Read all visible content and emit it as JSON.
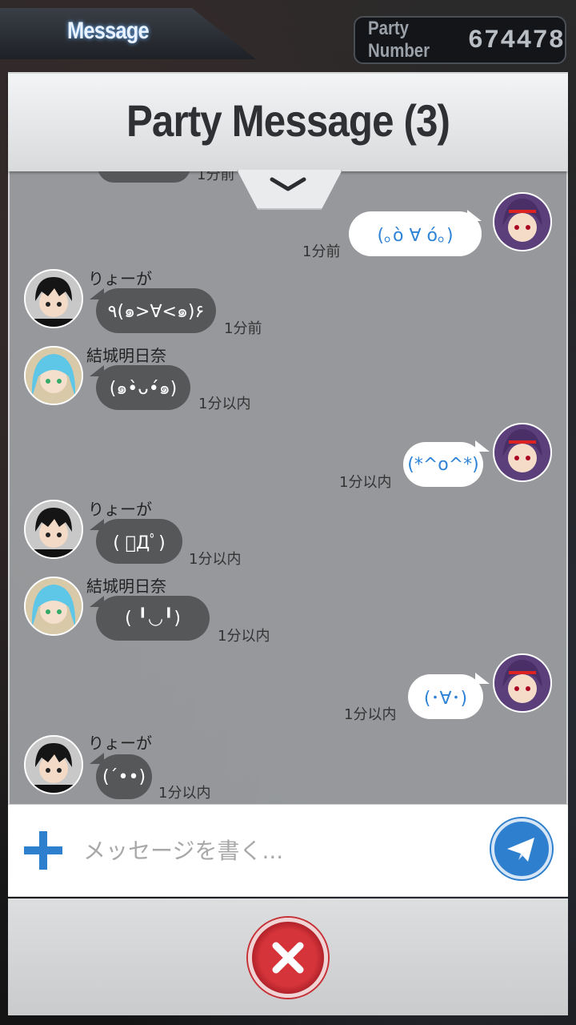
{
  "header": {
    "tab_label": "Message",
    "party_number_label": "Party Number",
    "party_number_value": "674478"
  },
  "dialog": {
    "title": "Party Message (3)"
  },
  "messages": [
    {
      "side": "right",
      "text": "(｡ò ∀ ó｡)",
      "time": "1分前"
    },
    {
      "side": "left",
      "name": "りょーが",
      "text": "٩(๑>∀<๑)۶",
      "time": "1分前",
      "avatar": "black-hair-avatar"
    },
    {
      "side": "left",
      "name": "結城明日奈",
      "text": "(๑•̀ᴗ•́๑)",
      "time": "1分以内",
      "avatar": "blue-hair-avatar"
    },
    {
      "side": "right",
      "text": "(*^o^*)",
      "time": "1分以内"
    },
    {
      "side": "left",
      "name": "りょーが",
      "text": "( ﾟДﾟ)",
      "time": "1分以内",
      "avatar": "black-hair-avatar"
    },
    {
      "side": "left",
      "name": "結城明日奈",
      "text": "( ╹◡╹)",
      "time": "1分以内",
      "avatar": "blue-hair-avatar"
    },
    {
      "side": "right",
      "text": "(･∀･)",
      "time": "1分以内"
    },
    {
      "side": "left",
      "name": "りょーが",
      "text": "(´••)",
      "time": "1分以内",
      "avatar": "black-hair-avatar"
    }
  ],
  "partial_top_time": "1分前",
  "input": {
    "placeholder": "メッセージを書く..."
  },
  "colors": {
    "accent": "#2f7fcf",
    "close": "#d6343b",
    "dark_bubble": "#555759",
    "light_bubble_text": "#2f83d6"
  }
}
